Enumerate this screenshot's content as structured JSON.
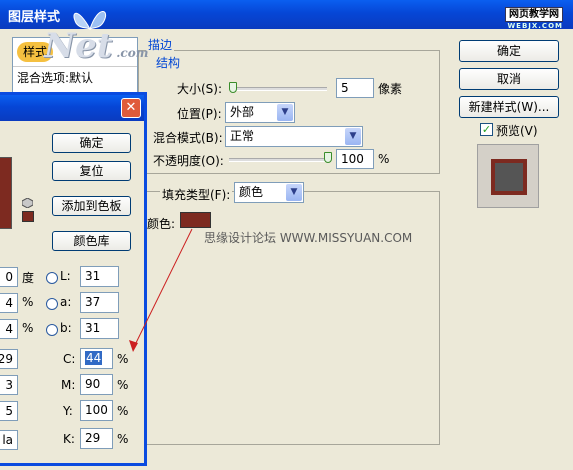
{
  "title": "图层样式",
  "watermark": {
    "logo": "Net",
    "logo_suffix": ".com",
    "site": "网页教学网",
    "site_sub": "WEBJX.COM",
    "overlay": "思缘设计论坛 WWW.MISSYUAN.COM"
  },
  "left_panel": {
    "items": [
      "样式",
      "混合选项:默认"
    ]
  },
  "stroke": {
    "legend": "描边",
    "section": "结构",
    "size_label": "大小(S):",
    "size_value": "5",
    "size_unit": "像素",
    "position_label": "位置(P):",
    "position_value": "外部",
    "blend_label": "混合模式(B):",
    "blend_value": "正常",
    "opacity_label": "不透明度(O):",
    "opacity_value": "100",
    "opacity_unit": "%",
    "fill_type_label": "填充类型(F):",
    "fill_type_value": "颜色",
    "color_label": "颜色:",
    "color_swatch": "#7d2a20"
  },
  "right_buttons": {
    "ok": "确定",
    "cancel": "取消",
    "new_style": "新建样式(W)...",
    "preview_label": "预览(V)"
  },
  "preview_colors": {
    "fill": "#555555",
    "stroke": "#7d2a20"
  },
  "picker": {
    "close": "✕",
    "ok": "确定",
    "reset": "复位",
    "add_swatch": "添加到色板",
    "color_library": "颜色库",
    "hsb": {
      "h_value": "0",
      "h_unit": "度",
      "s_value": "4",
      "s_unit": "%",
      "b_value": "4",
      "b_unit": "%"
    },
    "lab": {
      "l_label": "L:",
      "l_value": "31",
      "a_label": "a:",
      "a_value": "37",
      "b_label": "b:",
      "b_value": "31"
    },
    "rgb": {
      "r_value": "29",
      "g_value": "3",
      "b_value": "5"
    },
    "hex_value": "la",
    "cmyk": {
      "c_label": "C:",
      "c_value": "44",
      "m_label": "M:",
      "m_value": "90",
      "y_label": "Y:",
      "y_value": "100",
      "k_label": "K:",
      "k_value": "29",
      "unit": "%"
    }
  }
}
